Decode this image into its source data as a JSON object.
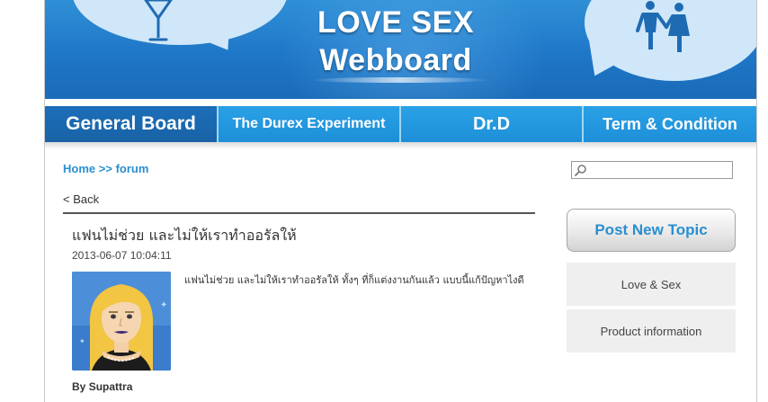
{
  "banner": {
    "title_line1": "LOVE SEX",
    "title_line2": "Webboard"
  },
  "nav": {
    "tabs": [
      {
        "label": "General Board",
        "active": true
      },
      {
        "label": "The Durex Experiment",
        "active": false
      },
      {
        "label": "Dr.D",
        "active": false
      },
      {
        "label": "Term & Condition",
        "active": false
      }
    ]
  },
  "breadcrumb": {
    "home": "Home",
    "separator": ">>",
    "current": "forum"
  },
  "back_link": "< Back",
  "topic": {
    "title": "แฟนไม่ช่วย และไม่ให้เราทำออรัลให้",
    "date": "2013-06-07 10:04:11",
    "body": "แฟนไม่ช่วย และไม่ให้เราทำออรัลให้ ทั้งๆ ที่ก็แต่งงานกันแล้ว แบบนี้แก้ปัญหาไงดี",
    "author_prefix": "By",
    "author": "Supattra"
  },
  "sidebar": {
    "search_placeholder": "",
    "post_button": "Post New Topic",
    "categories": [
      "Love & Sex",
      "Product information"
    ]
  },
  "colors": {
    "banner_blue": "#1f77c7",
    "nav_blue": "#2aa1e6",
    "nav_active": "#1b6fb8",
    "link_blue": "#2a8fd0"
  }
}
